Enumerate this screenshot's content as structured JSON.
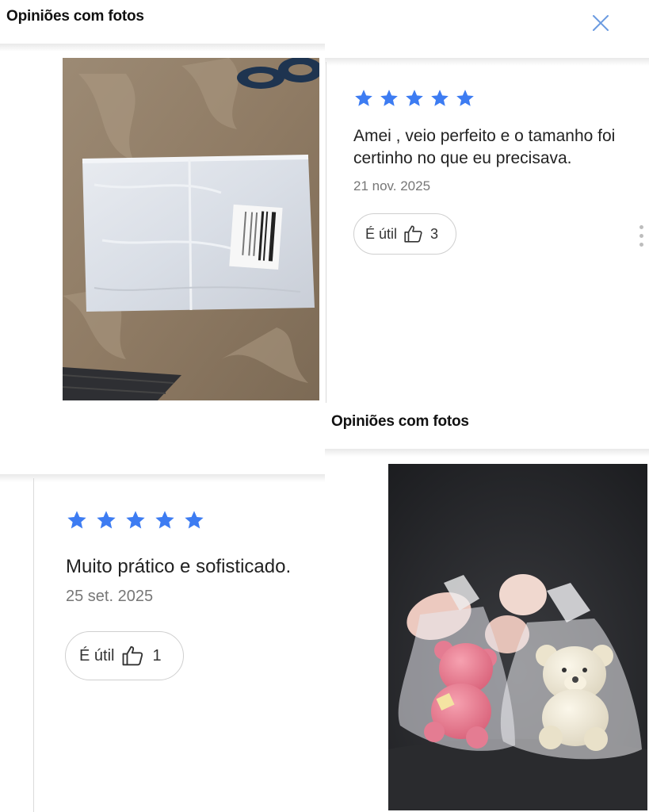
{
  "top_left": {
    "header": {
      "title": "Opiniões com fotos"
    },
    "photo": {
      "alt": "Saquinhos de organza brancos embalados"
    }
  },
  "top_right": {
    "review": {
      "rating": 5,
      "text": "Amei , veio perfeito e o tamanho foi certinho no que eu precisava.",
      "date": "21 nov. 2025",
      "useful_label": "É útil",
      "useful_count": "3"
    }
  },
  "bottom_left": {
    "review": {
      "rating": 5,
      "text": "Muito prático e sofisticado.",
      "date": "25 set. 2025",
      "useful_label": "É útil",
      "useful_count": "1"
    }
  },
  "bottom_right": {
    "header": {
      "title": "Opiniões com fotos"
    },
    "photo": {
      "alt": "Ursinhos em saquinhos de organza com tags"
    }
  },
  "colors": {
    "star": "#3d7cf2",
    "close": "#6a9ae0",
    "border": "#cfcfcf",
    "date": "#777777"
  },
  "icons": [
    "close-icon",
    "star-icon",
    "thumbs-up-icon",
    "more-options-icon"
  ]
}
